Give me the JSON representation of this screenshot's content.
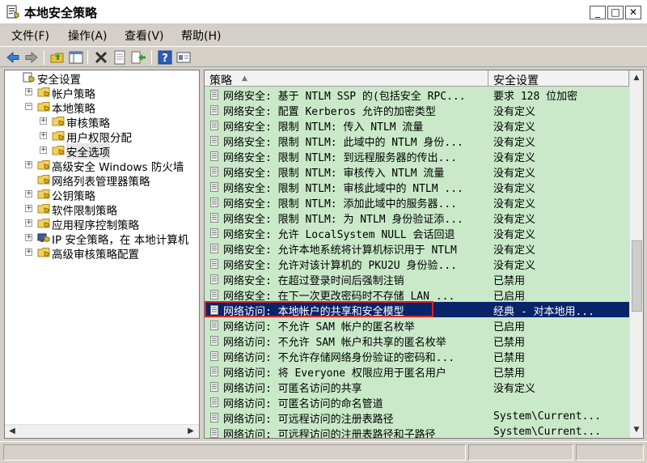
{
  "window": {
    "title": "本地安全策略"
  },
  "menu": [
    {
      "label": "文件(F)"
    },
    {
      "label": "操作(A)"
    },
    {
      "label": "查看(V)"
    },
    {
      "label": "帮助(H)"
    }
  ],
  "toolbar": [
    {
      "icon": "back-arrow-icon"
    },
    {
      "icon": "forward-arrow-icon"
    },
    {
      "icon": "up-folder-icon"
    },
    {
      "icon": "show-hide-console-tree-icon"
    },
    {
      "icon": "delete-icon"
    },
    {
      "icon": "properties-icon"
    },
    {
      "icon": "export-list-icon"
    },
    {
      "icon": "help-icon"
    },
    {
      "icon": "view-icon"
    }
  ],
  "tree": [
    {
      "label": "安全设置",
      "level": 0,
      "expander": "",
      "icon": "security-settings-icon"
    },
    {
      "label": "帐户策略",
      "level": 1,
      "expander": "+",
      "icon": "folder-icon"
    },
    {
      "label": "本地策略",
      "level": 1,
      "expander": "−",
      "icon": "folder-open-icon"
    },
    {
      "label": "审核策略",
      "level": 2,
      "expander": "+",
      "icon": "folder-icon"
    },
    {
      "label": "用户权限分配",
      "level": 2,
      "expander": "+",
      "icon": "folder-icon"
    },
    {
      "label": "安全选项",
      "level": 2,
      "expander": "+",
      "icon": "folder-icon",
      "selected": true
    },
    {
      "label": "高级安全 Windows 防火墙",
      "level": 1,
      "expander": "+",
      "icon": "folder-icon"
    },
    {
      "label": "网络列表管理器策略",
      "level": 1,
      "expander": "",
      "icon": "folder-icon"
    },
    {
      "label": "公钥策略",
      "level": 1,
      "expander": "+",
      "icon": "folder-icon"
    },
    {
      "label": "软件限制策略",
      "level": 1,
      "expander": "+",
      "icon": "folder-icon"
    },
    {
      "label": "应用程序控制策略",
      "level": 1,
      "expander": "+",
      "icon": "folder-icon"
    },
    {
      "label": "IP 安全策略，在 本地计算机",
      "level": 1,
      "expander": "+",
      "icon": "ip-security-icon"
    },
    {
      "label": "高级审核策略配置",
      "level": 1,
      "expander": "+",
      "icon": "folder-icon"
    }
  ],
  "list": {
    "columns": {
      "policy": "策略",
      "setting": "安全设置"
    },
    "rows": [
      {
        "policy": "网络安全: 基于 NTLM SSP 的(包括安全 RPC...",
        "setting": "要求 128 位加密"
      },
      {
        "policy": "网络安全: 配置 Kerberos 允许的加密类型",
        "setting": "没有定义"
      },
      {
        "policy": "网络安全: 限制 NTLM: 传入 NTLM 流量",
        "setting": "没有定义"
      },
      {
        "policy": "网络安全: 限制 NTLM: 此域中的 NTLM 身份...",
        "setting": "没有定义"
      },
      {
        "policy": "网络安全: 限制 NTLM: 到远程服务器的传出...",
        "setting": "没有定义"
      },
      {
        "policy": "网络安全: 限制 NTLM: 审核传入 NTLM 流量",
        "setting": "没有定义"
      },
      {
        "policy": "网络安全: 限制 NTLM: 审核此域中的 NTLM ...",
        "setting": "没有定义"
      },
      {
        "policy": "网络安全: 限制 NTLM: 添加此域中的服务器...",
        "setting": "没有定义"
      },
      {
        "policy": "网络安全: 限制 NTLM: 为 NTLM 身份验证添...",
        "setting": "没有定义"
      },
      {
        "policy": "网络安全: 允许 LocalSystem NULL 会话回退",
        "setting": "没有定义"
      },
      {
        "policy": "网络安全: 允许本地系统将计算机标识用于 NTLM",
        "setting": "没有定义"
      },
      {
        "policy": "网络安全: 允许对该计算机的 PKU2U 身份验...",
        "setting": "没有定义"
      },
      {
        "policy": "网络安全: 在超过登录时间后强制注销",
        "setting": "已禁用"
      },
      {
        "policy": "网络安全: 在下一次更改密码时不存储 LAN ...",
        "setting": "已启用"
      },
      {
        "policy": "网络访问: 本地帐户的共享和安全模型",
        "setting": "经典 - 对本地用...",
        "selected": true
      },
      {
        "policy": "网络访问: 不允许 SAM 帐户的匿名枚举",
        "setting": "已启用"
      },
      {
        "policy": "网络访问: 不允许 SAM 帐户和共享的匿名枚举",
        "setting": "已禁用"
      },
      {
        "policy": "网络访问: 不允许存储网络身份验证的密码和...",
        "setting": "已禁用"
      },
      {
        "policy": "网络访问: 将 Everyone 权限应用于匿名用户",
        "setting": "已禁用"
      },
      {
        "policy": "网络访问: 可匿名访问的共享",
        "setting": "没有定义"
      },
      {
        "policy": "网络访问: 可匿名访问的命名管道",
        "setting": ""
      },
      {
        "policy": "网络访问: 可远程访问的注册表路径",
        "setting": "System\\Current..."
      },
      {
        "policy": "网络访问: 可远程访问的注册表路径和子路径",
        "setting": "System\\Current..."
      }
    ]
  },
  "colors": {
    "list_bg": "#c9e9c9",
    "selection": "#0a246a",
    "highlight_box": "#e02020"
  }
}
